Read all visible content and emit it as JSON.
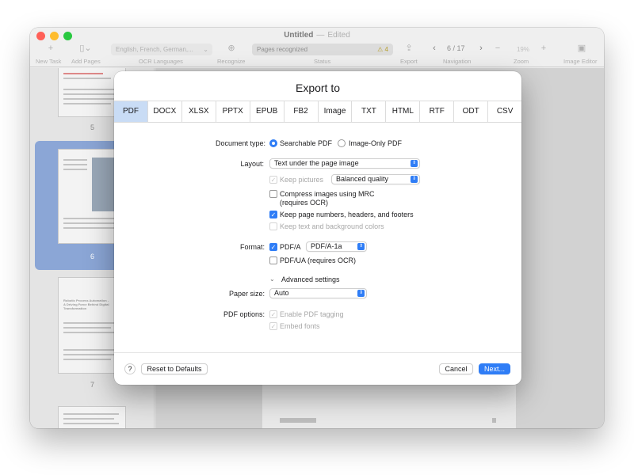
{
  "window": {
    "title": "Untitled",
    "separator": "—",
    "edited": "Edited"
  },
  "toolbar": {
    "new_task_label": "New Task",
    "add_pages_label": "Add Pages",
    "ocr_languages_value": "English, French, German,...",
    "ocr_languages_label": "OCR Languages",
    "recognize_label": "Recognize",
    "status_value": "Pages recognized",
    "status_warning_count": "4",
    "status_label": "Status",
    "export_label": "Export",
    "navigation_value": "6 / 17",
    "navigation_label": "Navigation",
    "zoom_value": "19%",
    "zoom_label": "Zoom",
    "image_editor_label": "Image Editor",
    "new_task_icon": "plus-icon",
    "add_pages_icon": "document-icon",
    "recognize_icon": "magnifier-icon",
    "export_icon": "share-icon",
    "image_editor_icon": "image-icon"
  },
  "sidebar": {
    "pages": [
      "5",
      "6",
      "7"
    ],
    "selected_page": "6",
    "page7_title": "Robotic Process Automation - A Driving Force Behind Digital Transformation"
  },
  "dialog": {
    "title": "Export to",
    "tabs": [
      "PDF",
      "DOCX",
      "XLSX",
      "PPTX",
      "EPUB",
      "FB2",
      "Image",
      "TXT",
      "HTML",
      "RTF",
      "ODT",
      "CSV"
    ],
    "active_tab": "PDF",
    "document_type": {
      "label": "Document type:",
      "option1": "Searchable PDF",
      "option2": "Image-Only PDF",
      "selected": "Searchable PDF"
    },
    "layout": {
      "label": "Layout:",
      "value": "Text under the page image",
      "keep_pictures": "Keep pictures",
      "quality_value": "Balanced quality",
      "compress_line1": "Compress images using MRC",
      "compress_line2": "(requires OCR)",
      "keep_page_numbers": "Keep page numbers, headers, and footers",
      "keep_text_colors": "Keep text and background colors"
    },
    "format": {
      "label": "Format:",
      "pdfa": "PDF/A",
      "pdfa_value": "PDF/A-1a",
      "pdfua": "PDF/UA (requires OCR)"
    },
    "advanced": "Advanced settings",
    "paper_size": {
      "label": "Paper size:",
      "value": "Auto"
    },
    "pdf_options": {
      "label": "PDF options:",
      "tagging": "Enable PDF tagging",
      "embed_fonts": "Embed fonts"
    },
    "footer": {
      "help": "?",
      "reset": "Reset to Defaults",
      "cancel": "Cancel",
      "next": "Next..."
    },
    "accent_color": "#2f7df6"
  }
}
